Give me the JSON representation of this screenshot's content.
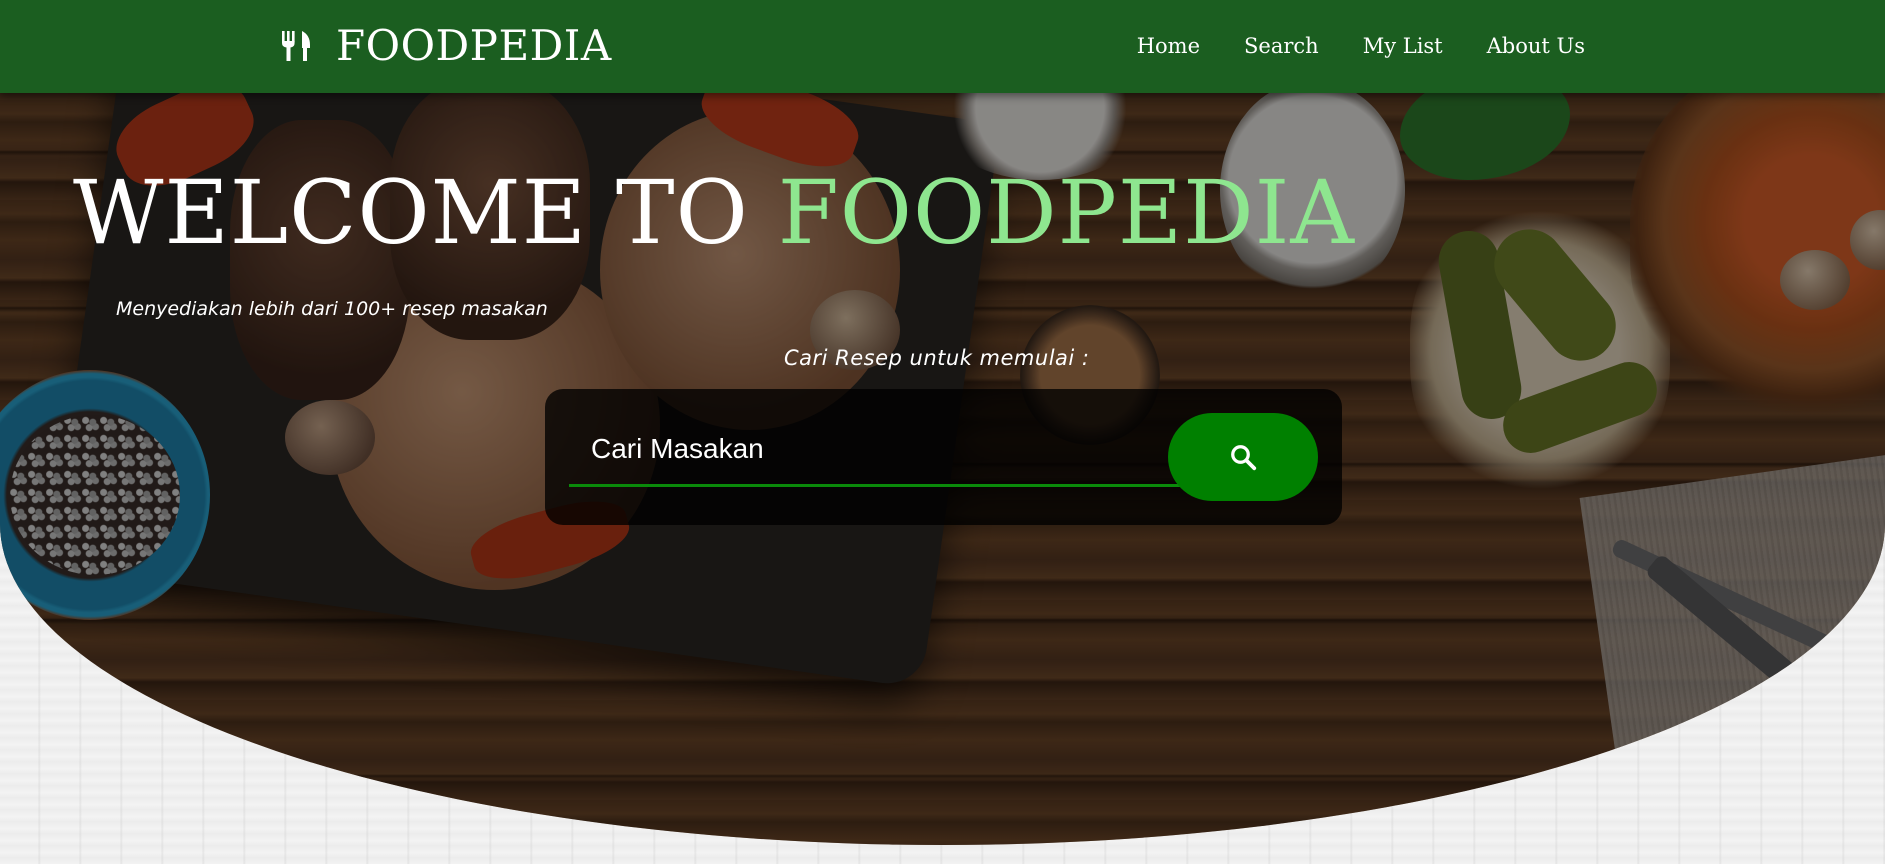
{
  "nav": {
    "brand": "FOODPEDIA",
    "brand_icon": "utensils-icon",
    "links": [
      {
        "label": "Home"
      },
      {
        "label": "Search"
      },
      {
        "label": "My List"
      },
      {
        "label": "About Us"
      }
    ]
  },
  "hero": {
    "title_prefix": "WELCOME TO",
    "title_accent": "FOODPEDIA",
    "subtitle": "Menyediakan lebih dari 100+ resep masakan",
    "search_caption": "Cari Resep untuk memulai :"
  },
  "search": {
    "placeholder": "Cari Masakan",
    "button_icon": "search-icon"
  },
  "colors": {
    "nav_bg": "#1b5e20",
    "accent": "#8ee68f",
    "search_button": "#008000",
    "search_underline": "#0a8a0a"
  }
}
